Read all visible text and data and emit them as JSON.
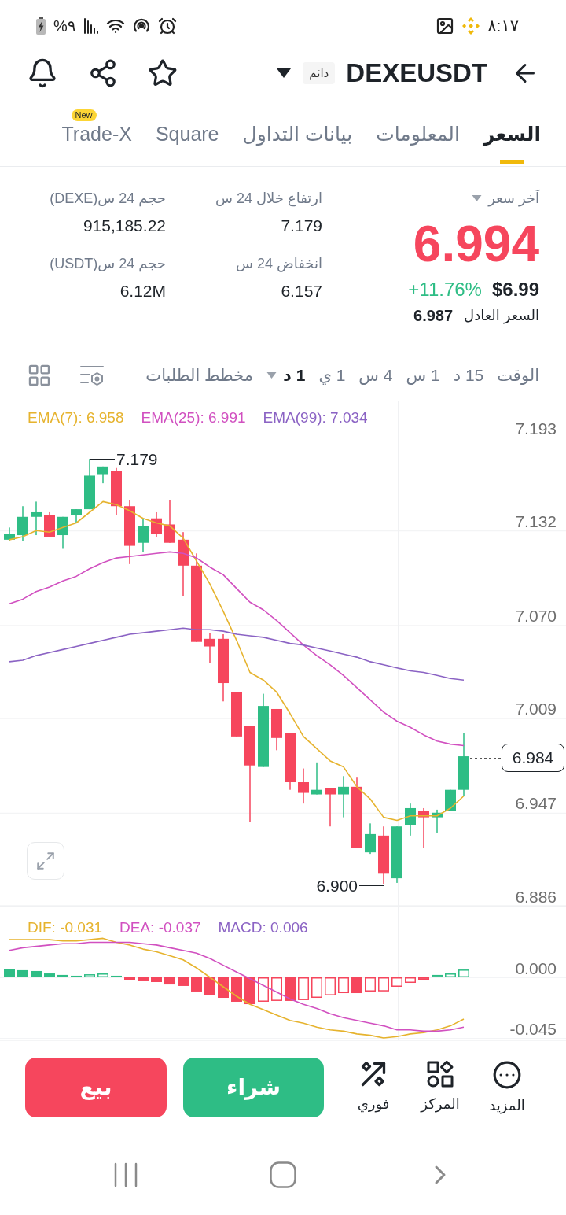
{
  "status_bar": {
    "time": "٨:١٧",
    "battery": "%٩"
  },
  "header": {
    "symbol": "DEXEUSDT",
    "badge": "دائم"
  },
  "tabs": [
    {
      "label": "السعر",
      "selected": true
    },
    {
      "label": "المعلومات",
      "selected": false
    },
    {
      "label": "بيانات التداول",
      "selected": false
    },
    {
      "label": "Square",
      "selected": false
    },
    {
      "label": "Trade-X",
      "selected": false,
      "badge": "New"
    }
  ],
  "price_panel": {
    "label": "آخر سعر",
    "last_price": "6.994",
    "usd_price": "$6.99",
    "change": "+11.76%",
    "fair_price_label": "السعر العادل",
    "fair_price": "6.987"
  },
  "stats": [
    {
      "label": "ارتفاع خلال 24 س",
      "value": "7.179"
    },
    {
      "label": "حجم 24 س(DEXE)",
      "value": "915,185.22"
    },
    {
      "label": "انخفاض 24 س",
      "value": "6.157"
    },
    {
      "label": "حجم 24 س(USDT)",
      "value": "6.12M"
    }
  ],
  "intervals": {
    "label": "الوقت",
    "items": [
      {
        "label": "15 د",
        "selected": false,
        "kind": "option"
      },
      {
        "label": "1 س",
        "selected": false,
        "kind": "option"
      },
      {
        "label": "4 س",
        "selected": false,
        "kind": "option"
      },
      {
        "label": "1 ي",
        "selected": false,
        "kind": "option"
      },
      {
        "label": "1 د",
        "selected": true,
        "kind": "dropdown"
      }
    ],
    "depth_chart": "مخطط الطلبات"
  },
  "chart": {
    "legend": [
      {
        "label": "EMA(99): 7.034",
        "color": "#8b63c4"
      },
      {
        "label": "EMA(25): 6.991",
        "color": "#d150c0"
      },
      {
        "label": "EMA(7): 6.958",
        "color": "#e6b32e"
      }
    ],
    "high_label": "7.179",
    "low_label": "6.900",
    "current_price": "6.984",
    "chart_data": {
      "type": "candlestick",
      "ohlc": [
        [
          7.126,
          7.134,
          7.125,
          7.13
        ],
        [
          7.129,
          7.148,
          7.125,
          7.141
        ],
        [
          7.141,
          7.151,
          7.129,
          7.144
        ],
        [
          7.142,
          7.144,
          7.128,
          7.128
        ],
        [
          7.129,
          7.141,
          7.12,
          7.141
        ],
        [
          7.142,
          7.146,
          7.137,
          7.146
        ],
        [
          7.146,
          7.179,
          7.146,
          7.168
        ],
        [
          7.169,
          7.174,
          7.163,
          7.174
        ],
        [
          7.171,
          7.173,
          7.142,
          7.148
        ],
        [
          7.148,
          7.152,
          7.11,
          7.122
        ],
        [
          7.124,
          7.14,
          7.118,
          7.135
        ],
        [
          7.14,
          7.144,
          7.128,
          7.13
        ],
        [
          7.136,
          7.152,
          7.124,
          7.124
        ],
        [
          7.126,
          7.131,
          7.089,
          7.109
        ],
        [
          7.109,
          7.117,
          7.059,
          7.059
        ],
        [
          7.061,
          7.065,
          7.045,
          7.056
        ],
        [
          7.061,
          7.064,
          7.02,
          7.032
        ],
        [
          7.026,
          7.026,
          6.997,
          6.997
        ],
        [
          7.004,
          7.004,
          6.941,
          6.978
        ],
        [
          6.977,
          7.025,
          6.977,
          7.017
        ],
        [
          7.015,
          7.015,
          6.988,
          6.996
        ],
        [
          6.999,
          6.999,
          6.962,
          6.967
        ],
        [
          6.967,
          6.976,
          6.953,
          6.96
        ],
        [
          6.959,
          6.98,
          6.959,
          6.962
        ],
        [
          6.963,
          6.963,
          6.938,
          6.959
        ],
        [
          6.959,
          6.971,
          6.944,
          6.964
        ],
        [
          6.964,
          6.97,
          6.924,
          6.924
        ],
        [
          6.921,
          6.94,
          6.92,
          6.933
        ],
        [
          6.932,
          6.938,
          6.9,
          6.907
        ],
        [
          6.904,
          6.938,
          6.901,
          6.938
        ],
        [
          6.939,
          6.953,
          6.932,
          6.95
        ],
        [
          6.948,
          6.95,
          6.924,
          6.944
        ],
        [
          6.944,
          6.949,
          6.934,
          6.947
        ],
        [
          6.948,
          6.962,
          6.948,
          6.962
        ],
        [
          6.962,
          6.999,
          6.958,
          6.984
        ]
      ],
      "ylim": [
        6.886,
        7.217
      ],
      "yticks": [
        {
          "value": 7.193,
          "label": "7.193"
        },
        {
          "value": 7.132,
          "label": "7.132"
        },
        {
          "value": 7.07,
          "label": "7.070"
        },
        {
          "value": 7.009,
          "label": "7.009"
        },
        {
          "value": 6.947,
          "label": "6.947"
        },
        {
          "value": 6.886,
          "label": "6.886"
        }
      ],
      "series": [
        {
          "type": "line",
          "color": "#e6b32e",
          "values": [
            7.126,
            7.128,
            7.132,
            7.131,
            7.134,
            7.137,
            7.144,
            7.151,
            7.149,
            7.145,
            7.14,
            7.137,
            7.135,
            7.127,
            7.112,
            7.097,
            7.079,
            7.06,
            7.039,
            7.034,
            7.026,
            7.012,
            6.997,
            6.989,
            6.981,
            6.977,
            6.964,
            6.956,
            6.944,
            6.942,
            6.945,
            6.945,
            6.945,
            6.95,
            6.958
          ]
        },
        {
          "type": "line",
          "color": "#d150c0",
          "values": [
            7.084,
            7.087,
            7.092,
            7.095,
            7.099,
            7.102,
            7.107,
            7.111,
            7.114,
            7.115,
            7.116,
            7.117,
            7.118,
            7.117,
            7.114,
            7.108,
            7.103,
            7.094,
            7.085,
            7.08,
            7.073,
            7.065,
            7.057,
            7.05,
            7.044,
            7.037,
            7.029,
            7.021,
            7.013,
            7.007,
            7.003,
            6.998,
            6.994,
            6.992,
            6.991
          ]
        },
        {
          "type": "line",
          "color": "#8b63c4",
          "values": [
            7.046,
            7.047,
            7.05,
            7.052,
            7.054,
            7.056,
            7.058,
            7.06,
            7.062,
            7.064,
            7.065,
            7.066,
            7.067,
            7.068,
            7.067,
            7.067,
            7.066,
            7.064,
            7.063,
            7.062,
            7.06,
            7.058,
            7.057,
            7.055,
            7.053,
            7.051,
            7.049,
            7.046,
            7.044,
            7.042,
            7.04,
            7.039,
            7.037,
            7.035,
            7.034
          ]
        }
      ]
    }
  },
  "macd": {
    "legend": [
      {
        "label": "MACD: 0.006",
        "color": "#8b63c4"
      },
      {
        "label": "DEA: -0.037",
        "color": "#d150c0"
      },
      {
        "label": "DIF: -0.031",
        "color": "#e6b32e"
      }
    ],
    "chart_data": {
      "type": "bar",
      "ylim": [
        -0.0468,
        0.0526
      ],
      "yticks": [
        {
          "value": 0,
          "label": "0.000"
        },
        {
          "value": -0.045,
          "label": "-0.045"
        }
      ],
      "series": [
        {
          "type": "bar",
          "color": "#2ebd85",
          "values": [
            0.0064,
            0.0053,
            0.0047,
            0.0029,
            0.0018,
            0.0012,
            0.0023,
            0.0029,
            0.0012,
            null,
            null,
            null,
            null,
            null,
            null,
            null,
            null,
            null,
            null,
            null,
            null,
            null,
            null,
            null,
            null,
            null,
            null,
            null,
            null,
            null,
            null,
            null,
            0.0018,
            0.0029,
            0.0058
          ]
        },
        {
          "type": "bar",
          "color": "#f6465d",
          "values": [
            null,
            null,
            null,
            null,
            null,
            null,
            null,
            null,
            null,
            -0.0018,
            -0.0029,
            -0.0035,
            -0.0053,
            -0.0064,
            -0.0105,
            -0.0129,
            -0.0152,
            -0.0181,
            -0.0199,
            -0.0181,
            -0.0175,
            -0.0175,
            -0.0169,
            -0.0152,
            -0.0134,
            -0.0117,
            -0.0117,
            -0.0105,
            -0.0104,
            -0.007,
            -0.0041,
            -0.0018,
            null,
            null,
            null
          ]
        },
        {
          "type": "line",
          "color": "#e6b32e",
          "values": [
            0.028,
            0.028,
            0.028,
            0.028,
            0.027,
            0.027,
            0.028,
            0.029,
            0.026,
            0.024,
            0.021,
            0.019,
            0.016,
            0.013,
            0.007,
            0.0,
            -0.007,
            -0.014,
            -0.02,
            -0.024,
            -0.028,
            -0.032,
            -0.034,
            -0.037,
            -0.039,
            -0.04,
            -0.042,
            -0.043,
            -0.045,
            -0.044,
            -0.042,
            -0.041,
            -0.039,
            -0.036,
            -0.031
          ]
        },
        {
          "type": "line",
          "color": "#d150c0",
          "values": [
            0.02,
            0.022,
            0.023,
            0.024,
            0.025,
            0.025,
            0.026,
            0.026,
            0.026,
            0.026,
            0.025,
            0.024,
            0.022,
            0.02,
            0.018,
            0.014,
            0.009,
            0.004,
            -0.001,
            -0.006,
            -0.011,
            -0.016,
            -0.02,
            -0.023,
            -0.027,
            -0.03,
            -0.032,
            -0.034,
            -0.036,
            -0.039,
            -0.039,
            -0.04,
            -0.04,
            -0.039,
            -0.037
          ]
        }
      ]
    }
  },
  "actions": {
    "tools": [
      {
        "label": "المزيد",
        "kind": "more"
      },
      {
        "label": "المركز",
        "kind": "position"
      },
      {
        "label": "فوري",
        "kind": "convert"
      }
    ],
    "buy": "شراء",
    "sell": "بيع"
  }
}
